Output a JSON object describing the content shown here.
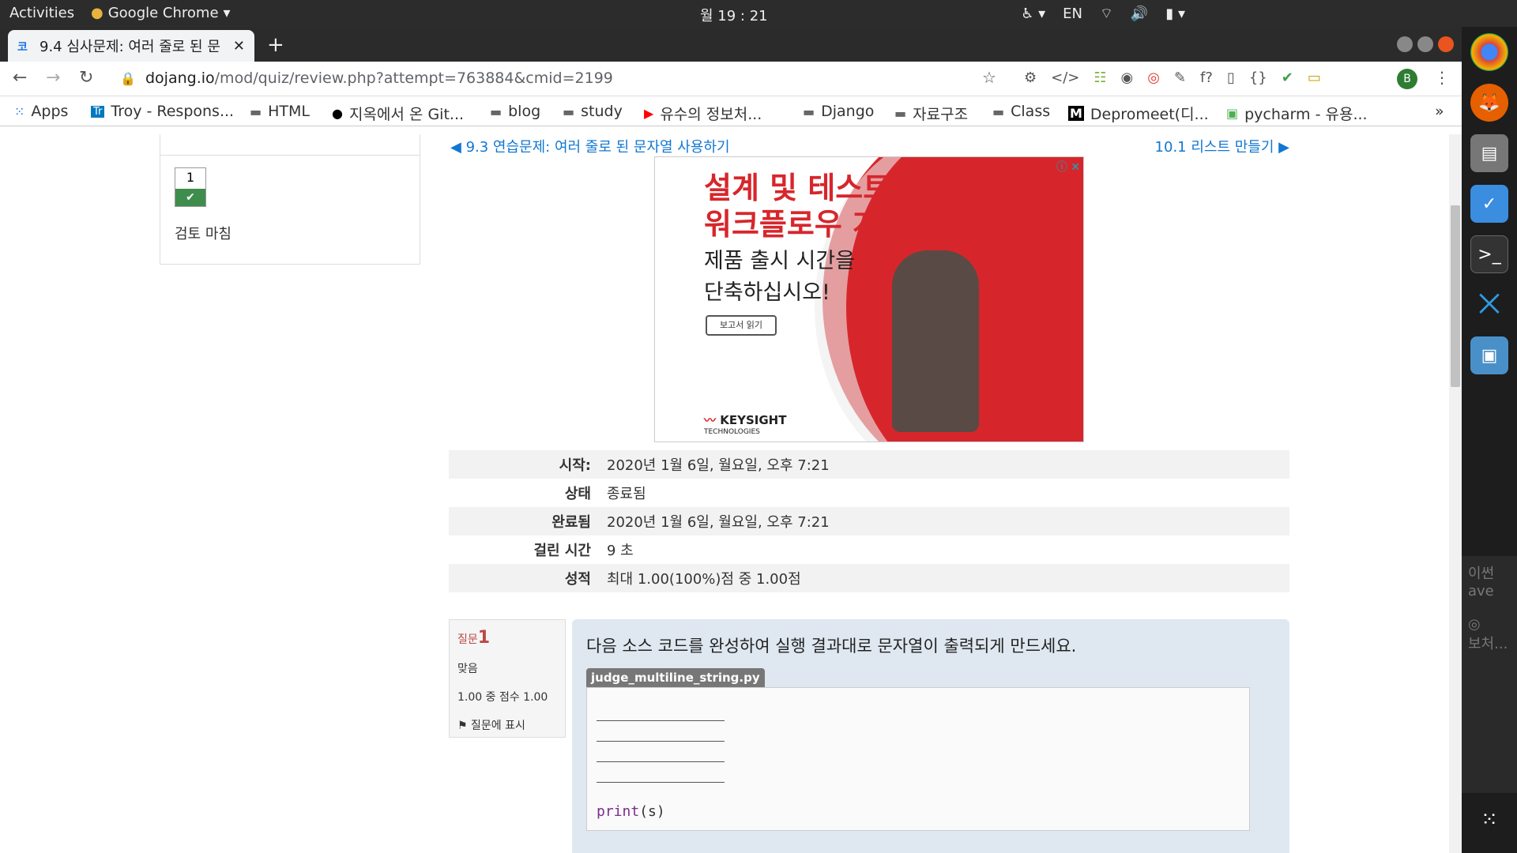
{
  "topbar": {
    "activities": "Activities",
    "app": "Google Chrome",
    "clock": "월 19 : 21",
    "lang": "EN"
  },
  "tab": {
    "title": "9.4 심사문제: 여러 줄로 된 문"
  },
  "url": {
    "domain": "dojang.io",
    "path": "/mod/quiz/review.php?attempt=763884&cmid=2199"
  },
  "avatar": "B",
  "bookmarks": [
    {
      "label": "Apps"
    },
    {
      "label": "Troy - Respons..."
    },
    {
      "label": "HTML"
    },
    {
      "label": "지옥에서 온 Git..."
    },
    {
      "label": "blog"
    },
    {
      "label": "study"
    },
    {
      "label": "유수의 정보처..."
    },
    {
      "label": "Django"
    },
    {
      "label": "자료구조"
    },
    {
      "label": "Class"
    },
    {
      "label": "Depromeet(디..."
    },
    {
      "label": "pycharm - 유용..."
    }
  ],
  "quiznav": {
    "question_number": "1",
    "finish_review": "검토 마침"
  },
  "links": {
    "prev": "◀ 9.3 연습문제: 여러 줄로 된 문자열 사용하기",
    "next": "10.1 리스트 만들기 ▶"
  },
  "ad": {
    "headline_line1": "설계 및 테스트",
    "headline_line2": "워크플로우 개선으로",
    "sub_line1": "제품 출시 시간을",
    "sub_line2": "단축하십시오!",
    "cta": "보고서 읽기",
    "brand": "KEYSIGHT",
    "brand_sub": "TECHNOLOGIES"
  },
  "summary": [
    {
      "key": "시작:",
      "value": "2020년 1월 6일, 월요일, 오후 7:21"
    },
    {
      "key": "상태",
      "value": "종료됨"
    },
    {
      "key": "완료됨",
      "value": "2020년 1월 6일, 월요일, 오후 7:21"
    },
    {
      "key": "걸린 시간",
      "value": "9 초"
    },
    {
      "key": "성적",
      "value": "최대 1.00(100%)점 중 1.00점"
    }
  ],
  "question": {
    "label": "질문",
    "number": "1",
    "state": "맞음",
    "grade": "1.00 중 점수 1.00",
    "flag": "질문에 표시",
    "text": "다음 소스 코드를 완성하여 실행 결과대로 문자열이 출력되게 만드세요.",
    "filename": "judge_multiline_string.py",
    "code_keyword": "print",
    "code_rest": "(s)"
  }
}
